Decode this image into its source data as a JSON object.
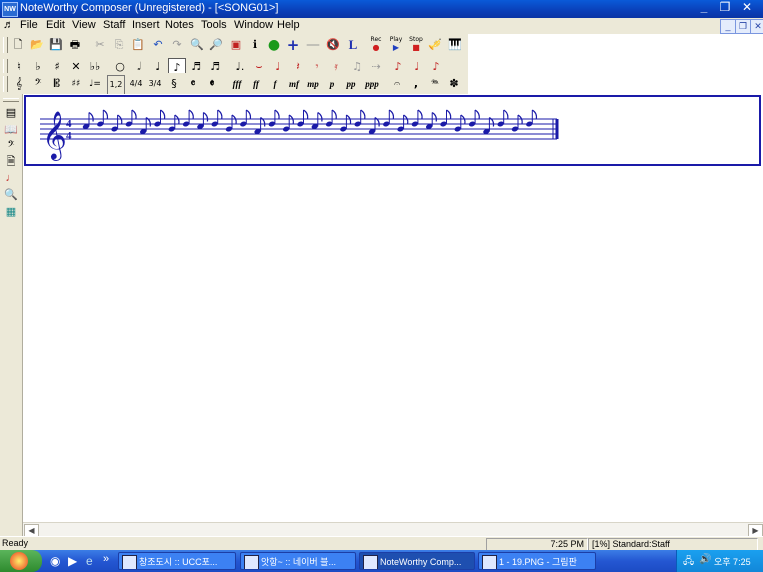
{
  "window": {
    "app_icon_text": "NW",
    "title": "NoteWorthy Composer (Unregistered) - [<SONG01>]",
    "minimize": "_",
    "maximize": "❐",
    "close": "✕"
  },
  "menu": {
    "items": [
      "File",
      "Edit",
      "View",
      "Staff",
      "Insert",
      "Notes",
      "Tools",
      "Window",
      "Help"
    ],
    "mdi_minimize": "_",
    "mdi_restore": "❐",
    "mdi_close": "✕"
  },
  "toolbar1": {
    "buttons": [
      "new",
      "open",
      "save",
      "print",
      "cut",
      "copy",
      "paste",
      "undo",
      "redo",
      "zoom-in",
      "zoom-out",
      "page",
      "info",
      "green-circle",
      "plus",
      "minus",
      "mute",
      "L"
    ],
    "rec_label": "Rec",
    "play_label": "Play",
    "stop_label": "Stop"
  },
  "toolbar2": {
    "glyphs": [
      "♮",
      "♭",
      "♯",
      "𝄪",
      "𝄫",
      "𝅝",
      "𝅗𝅥",
      "♩",
      "♪",
      "𝅘𝅥𝅯",
      "𝅘𝅥𝅰",
      "♩.",
      "♪",
      "♩",
      "𝄽",
      "𝄾",
      "𝄿",
      "♫",
      "𝆝",
      "♪",
      "♩",
      "♪"
    ]
  },
  "toolbar3": {
    "glyphs": [
      "𝄞",
      "𝄢",
      "𝄡",
      "♯♯",
      "♩=",
      "1,2",
      "4/4",
      "3/4",
      "𝄴",
      "𝄵",
      "fff",
      "ff",
      "f",
      "mf",
      "mp",
      "p",
      "pp",
      "ppp",
      "𝄐",
      ",",
      "𝆮",
      "✽"
    ]
  },
  "lefttoolbar": {
    "icons": [
      "staff-icon",
      "book-icon",
      "instrument-icon",
      "page-icon",
      "note-red-icon",
      "magnifier-icon",
      "grid-icon"
    ]
  },
  "score": {
    "clef": "𝄞",
    "time_signature_top": "4",
    "time_signature_bottom": "4",
    "note_pattern": [
      "eighth-a",
      "eighth-c",
      "eighth-b",
      "eighth-c",
      "eighth-g",
      "eighth-c",
      "eighth-b",
      "eighth-c"
    ],
    "repeat_count": 4,
    "colors": {
      "staff": "#1a1aa8",
      "notes": "#1a1aa8"
    }
  },
  "status": {
    "left": "Ready",
    "time": "7:25 PM",
    "staff_info": "[1%] Standard:Staff"
  },
  "taskbar": {
    "tasks": [
      {
        "label": "창조도시 :: UCC포...",
        "active": false
      },
      {
        "label": "앗항~ :: 네이버 블...",
        "active": false
      },
      {
        "label": "NoteWorthy Comp...",
        "active": true
      },
      {
        "label": "1 - 19.PNG - 그림판",
        "active": false
      }
    ],
    "quick_chevron": "»",
    "clock": "오후 7:25"
  }
}
